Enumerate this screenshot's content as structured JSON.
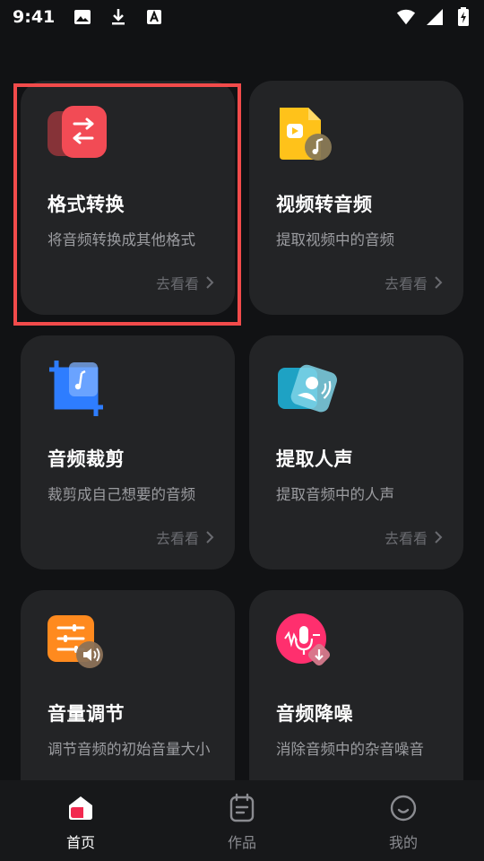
{
  "status_bar": {
    "time": "9:41",
    "left_icons": [
      "image-icon",
      "download-icon",
      "text-a-icon"
    ],
    "right_icons": [
      "wifi-icon",
      "signal-icon",
      "battery-charging-icon"
    ]
  },
  "cards": [
    {
      "title": "格式转换",
      "desc": "将音频转换成其他格式",
      "more": "去看看",
      "icon": "format-convert-icon",
      "accent": "#f24b55"
    },
    {
      "title": "视频转音频",
      "desc": "提取视频中的音频",
      "more": "去看看",
      "icon": "video-to-audio-icon",
      "accent": "#ffc21a"
    },
    {
      "title": "音频裁剪",
      "desc": "裁剪成自己想要的音频",
      "more": "去看看",
      "icon": "audio-crop-icon",
      "accent": "#2e7dff"
    },
    {
      "title": "提取人声",
      "desc": "提取音频中的人声",
      "more": "去看看",
      "icon": "extract-voice-icon",
      "accent": "#29b6d8"
    },
    {
      "title": "音量调节",
      "desc": "调节音频的初始音量大小",
      "more": "",
      "icon": "volume-adjust-icon",
      "accent": "#ff8a1e"
    },
    {
      "title": "音频降噪",
      "desc": "消除音频中的杂音噪音",
      "more": "",
      "icon": "noise-reduction-icon",
      "accent": "#ff2f6e"
    }
  ],
  "bottom_nav": [
    {
      "label": "首页",
      "icon": "home-icon",
      "active": true
    },
    {
      "label": "作品",
      "icon": "works-icon",
      "active": false
    },
    {
      "label": "我的",
      "icon": "profile-icon",
      "active": false
    }
  ],
  "colors": {
    "background": "#111214",
    "card": "#232426",
    "highlight": "#f24b4b"
  }
}
